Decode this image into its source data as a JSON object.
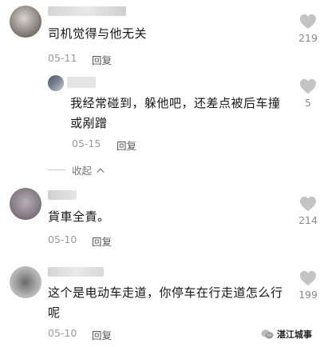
{
  "comments": [
    {
      "text": "司机觉得与他无关",
      "date": "05-11",
      "reply_label": "回复",
      "likes": "219"
    },
    {
      "text_line1": "我经常碰到，躲他吧，还差点被后车撞",
      "text_line2": "或剐蹭",
      "date": "05-15",
      "reply_label": "回复",
      "likes": "5"
    },
    {
      "text": "貨車全責。",
      "date": "05-10",
      "reply_label": "回复",
      "likes": "214"
    },
    {
      "text_line1": "这个是电动车走道，你停车在行走道怎么行",
      "text_line2": "呢",
      "date": "05-10",
      "reply_label": "回复",
      "likes": "199"
    }
  ],
  "collapse_label": "收起",
  "watermark": "湛江城事",
  "icons": {
    "like": "heart-icon",
    "collapse": "chevron-up-icon",
    "watermark": "wechat-icon"
  },
  "colors": {
    "heart": "#c4c4c4",
    "meta_text": "#9a9a9a"
  }
}
